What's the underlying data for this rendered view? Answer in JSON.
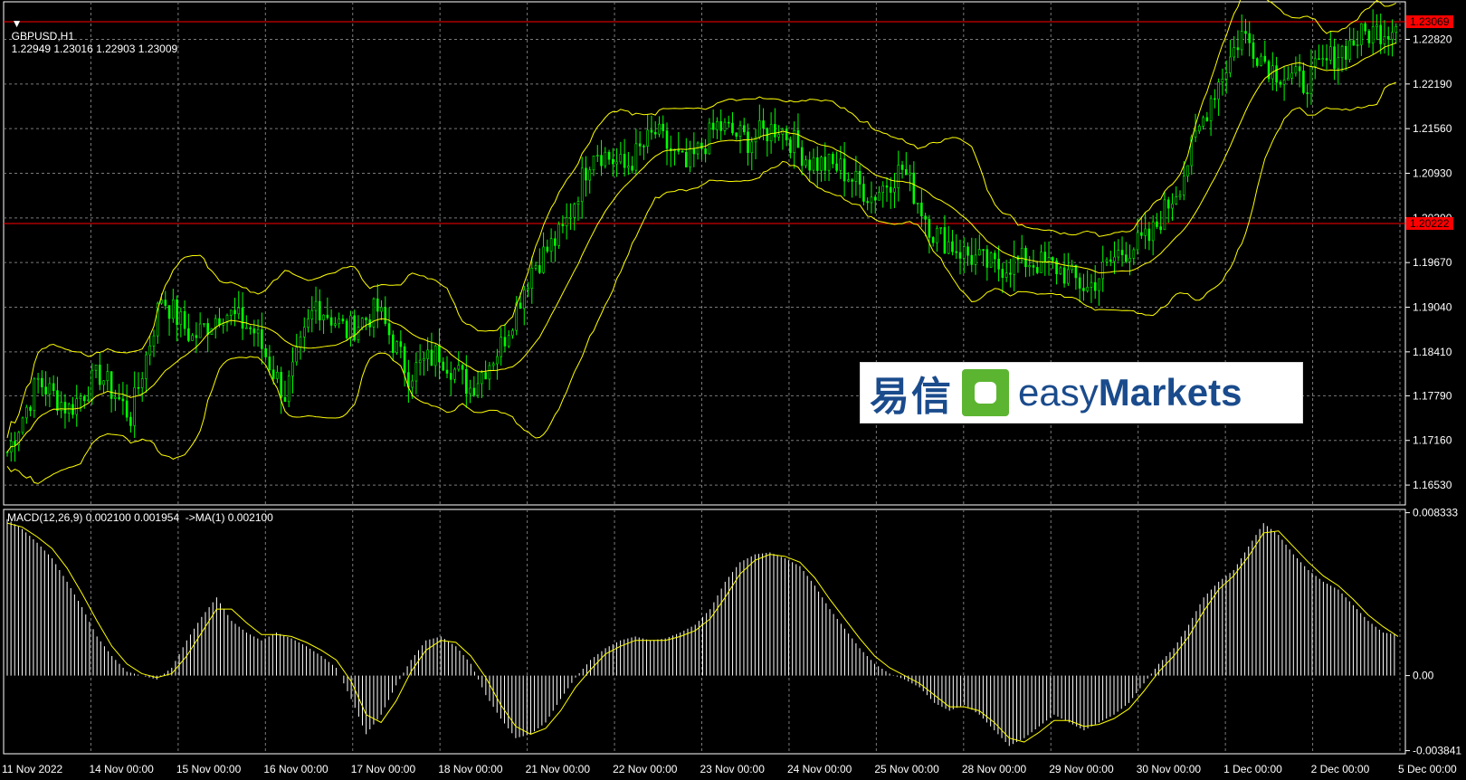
{
  "header": {
    "symbol": "GBPUSD,H1",
    "ohlc": "1.22949 1.23016 1.22903 1.23009"
  },
  "macd_label": "MACD(12,26,9) 0.002100 0.001954  ->MA(1) 0.002100",
  "logo": {
    "cn": "易信",
    "en_light": "easy",
    "en_bold": "Markets"
  },
  "colors": {
    "candle": "#00ff00",
    "bands": "#ffff00",
    "grid": "#7a7a7a",
    "hline": "#ff0000",
    "hist": "#ffffff",
    "signal": "#ffff00"
  },
  "chart_data": [
    {
      "type": "line",
      "title": "GBPUSD,H1",
      "x": [
        "11 Nov 2022",
        "14 Nov 00:00",
        "15 Nov 00:00",
        "16 Nov 00:00",
        "17 Nov 00:00",
        "18 Nov 00:00",
        "21 Nov 00:00",
        "22 Nov 00:00",
        "23 Nov 00:00",
        "24 Nov 00:00",
        "25 Nov 00:00",
        "28 Nov 00:00",
        "29 Nov 00:00",
        "30 Nov 00:00",
        "1 Dec 00:00",
        "2 Dec 00:00",
        "5 Dec 00:00"
      ],
      "y_ticks": [
        "1.22820",
        "1.22190",
        "1.21560",
        "1.20930",
        "1.20300",
        "1.19670",
        "1.19040",
        "1.18410",
        "1.17790",
        "1.17160",
        "1.16530"
      ],
      "ylim": [
        1.1625,
        1.2335
      ],
      "price_lines": [
        {
          "label": "1.23069",
          "value": 1.23069
        },
        {
          "label": "1.20222",
          "value": 1.20222
        }
      ],
      "series": [
        {
          "values": [
            1.17,
            1.18,
            1.176,
            1.181,
            1.175,
            1.192,
            1.186,
            1.19,
            1.187,
            1.178,
            1.191,
            1.187,
            1.19,
            1.181,
            1.184,
            1.179,
            1.185,
            1.196,
            1.201,
            1.213,
            1.21,
            1.215,
            1.21,
            1.216,
            1.214,
            1.216,
            1.211,
            1.21,
            1.206,
            1.21,
            1.201,
            1.198,
            1.196,
            1.197,
            1.196,
            1.193,
            1.198,
            1.2,
            1.208,
            1.22,
            1.229,
            1.224,
            1.222,
            1.226,
            1.229,
            1.23
          ]
        }
      ]
    },
    {
      "type": "bar",
      "title": "MACD(12,26,9) 0.002100 0.001954  ->MA(1) 0.002100",
      "y_ticks": [
        "0.008333",
        "0.00",
        "-0.003841"
      ],
      "ylim": [
        -0.004,
        0.0085
      ],
      "series": [
        {
          "values": [
            0.008,
            0.0075,
            0.0068,
            0.006,
            0.0048,
            0.0035,
            0.002,
            0.001,
            0.0002,
            0.0,
            -0.0002,
            0.0004,
            0.0018,
            0.003,
            0.004,
            0.0028,
            0.0022,
            0.0018,
            0.0022,
            0.0019,
            0.0015,
            0.001,
            0.0004,
            -0.0012,
            -0.003,
            -0.002,
            -0.0005,
            0.0008,
            0.0018,
            0.002,
            0.0015,
            0.0006,
            -0.001,
            -0.0022,
            -0.0032,
            -0.003,
            -0.0024,
            -0.0012,
            -0.0001,
            0.0008,
            0.0014,
            0.0018,
            0.002,
            0.0018,
            0.0019,
            0.0022,
            0.0026,
            0.0034,
            0.0048,
            0.0058,
            0.0062,
            0.0063,
            0.006,
            0.0056,
            0.0046,
            0.0034,
            0.0024,
            0.0014,
            0.0006,
            0.0001,
            -0.0002,
            -0.0006,
            -0.0014,
            -0.0018,
            -0.0015,
            -0.002,
            -0.0028,
            -0.0036,
            -0.0032,
            -0.0026,
            -0.002,
            -0.0024,
            -0.0028,
            -0.0024,
            -0.002,
            -0.0014,
            -0.0004,
            0.0006,
            0.0014,
            0.0026,
            0.004,
            0.0048,
            0.0054,
            0.0066,
            0.0078,
            0.0072,
            0.0062,
            0.0054,
            0.0048,
            0.0044,
            0.0036,
            0.0028,
            0.0022,
            0.0021
          ]
        },
        {
          "values": [
            0.0078,
            0.0076,
            0.0071,
            0.0065,
            0.0055,
            0.0042,
            0.0028,
            0.0015,
            0.0006,
            0.0001,
            -0.0001,
            0.0001,
            0.001,
            0.0022,
            0.0034,
            0.0034,
            0.0027,
            0.0021,
            0.0021,
            0.002,
            0.0017,
            0.0013,
            0.0008,
            -0.0003,
            -0.002,
            -0.0024,
            -0.0013,
            0.0002,
            0.0013,
            0.0018,
            0.0017,
            0.001,
            -0.0001,
            -0.0015,
            -0.0026,
            -0.003,
            -0.0027,
            -0.0018,
            -0.0006,
            0.0003,
            0.0011,
            0.0015,
            0.0018,
            0.0018,
            0.0018,
            0.002,
            0.0023,
            0.0029,
            0.004,
            0.0052,
            0.0059,
            0.0062,
            0.0061,
            0.0058,
            0.005,
            0.0039,
            0.0029,
            0.0019,
            0.001,
            0.0004,
            0.0,
            -0.0004,
            -0.001,
            -0.0016,
            -0.0016,
            -0.0018,
            -0.0024,
            -0.0032,
            -0.0034,
            -0.0029,
            -0.0023,
            -0.0023,
            -0.0026,
            -0.0025,
            -0.0022,
            -0.0017,
            -0.0008,
            0.0002,
            0.001,
            0.002,
            0.0033,
            0.0044,
            0.0051,
            0.0061,
            0.0073,
            0.0074,
            0.0066,
            0.0058,
            0.0051,
            0.0046,
            0.0039,
            0.0031,
            0.0025,
            0.002
          ]
        }
      ]
    }
  ]
}
